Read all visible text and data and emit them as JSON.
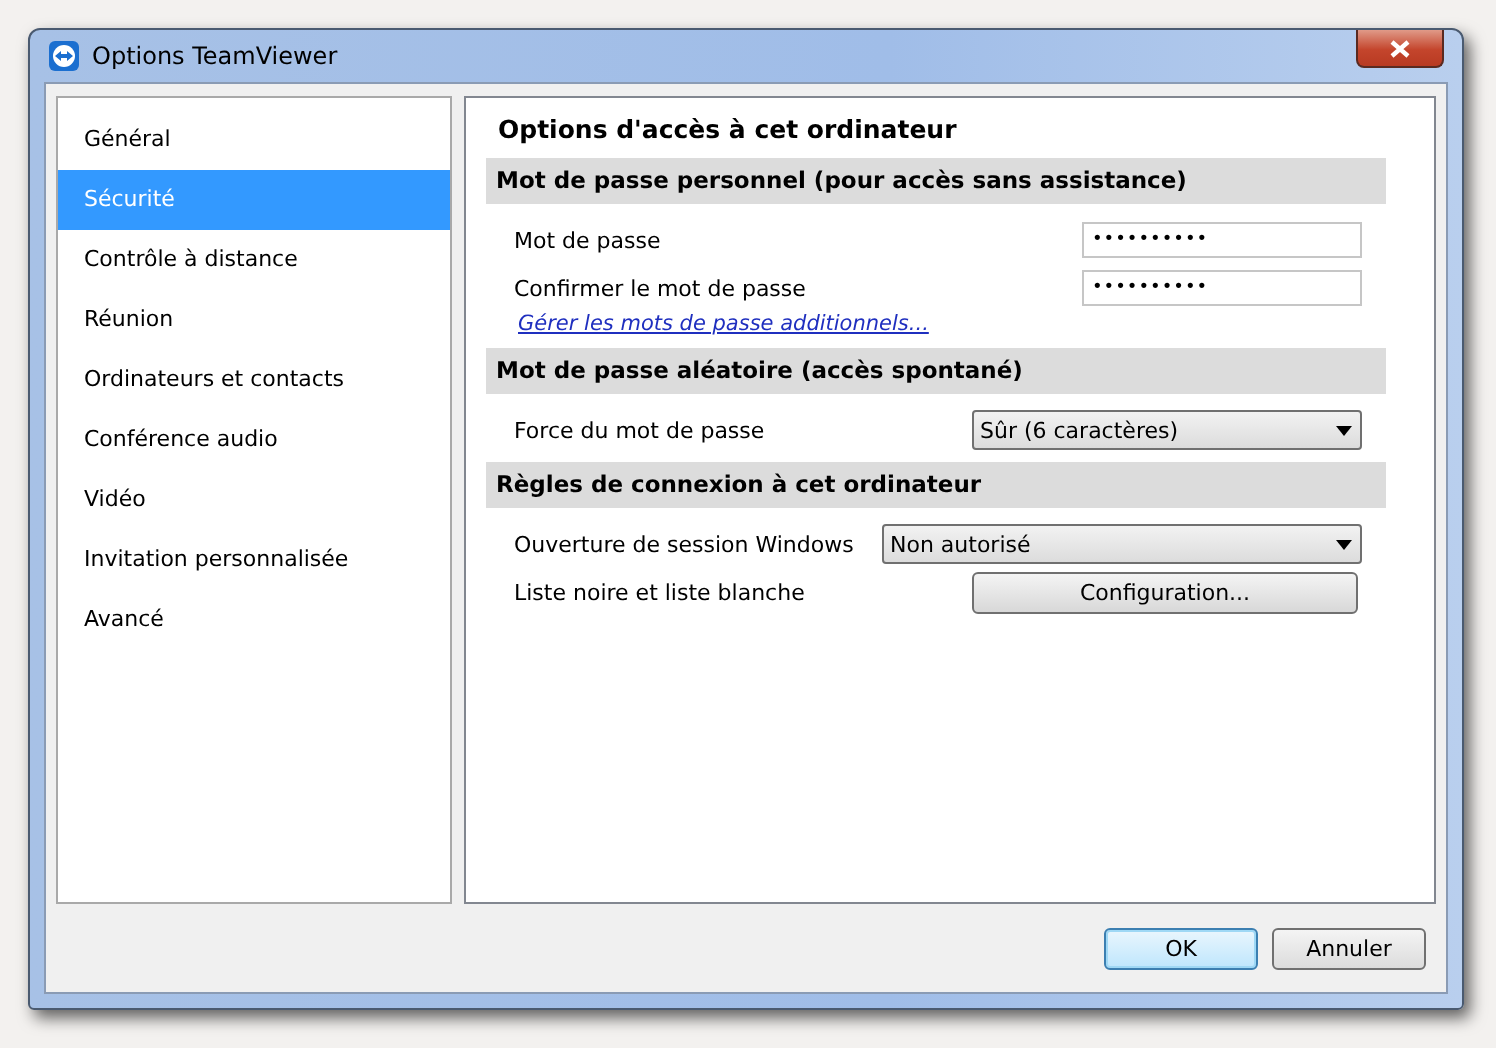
{
  "window": {
    "title": "Options TeamViewer"
  },
  "sidebar": {
    "items": [
      {
        "label": "Général",
        "selected": false
      },
      {
        "label": "Sécurité",
        "selected": true
      },
      {
        "label": "Contrôle à distance",
        "selected": false
      },
      {
        "label": "Réunion",
        "selected": false
      },
      {
        "label": "Ordinateurs et contacts",
        "selected": false
      },
      {
        "label": "Conférence audio",
        "selected": false
      },
      {
        "label": "Vidéo",
        "selected": false
      },
      {
        "label": "Invitation personnalisée",
        "selected": false
      },
      {
        "label": "Avancé",
        "selected": false
      }
    ]
  },
  "content": {
    "title": "Options d'accès à cet ordinateur",
    "sections": [
      {
        "title": "Mot de passe personnel (pour accès sans assistance)",
        "rows": [
          {
            "kind": "password",
            "label": "Mot de passe",
            "value": "••••••••••"
          },
          {
            "kind": "password",
            "label": "Confirmer le mot de passe",
            "value": "••••••••••"
          },
          {
            "kind": "link",
            "label": "Gérer les mots de passe additionnels..."
          }
        ]
      },
      {
        "title": "Mot de passe aléatoire (accès spontané)",
        "rows": [
          {
            "kind": "dropdown",
            "label": "Force du mot de passe",
            "value": "Sûr (6 caractères)"
          }
        ]
      },
      {
        "title": "Règles de connexion à cet ordinateur",
        "rows": [
          {
            "kind": "dropdown",
            "label": "Ouverture de session Windows",
            "value": "Non autorisé",
            "wide": true
          },
          {
            "kind": "button",
            "label": "Liste noire et liste blanche",
            "value": "Configuration..."
          }
        ]
      }
    ]
  },
  "buttons": [
    {
      "label": "OK",
      "default": true
    },
    {
      "label": "Annuler",
      "default": false
    }
  ]
}
